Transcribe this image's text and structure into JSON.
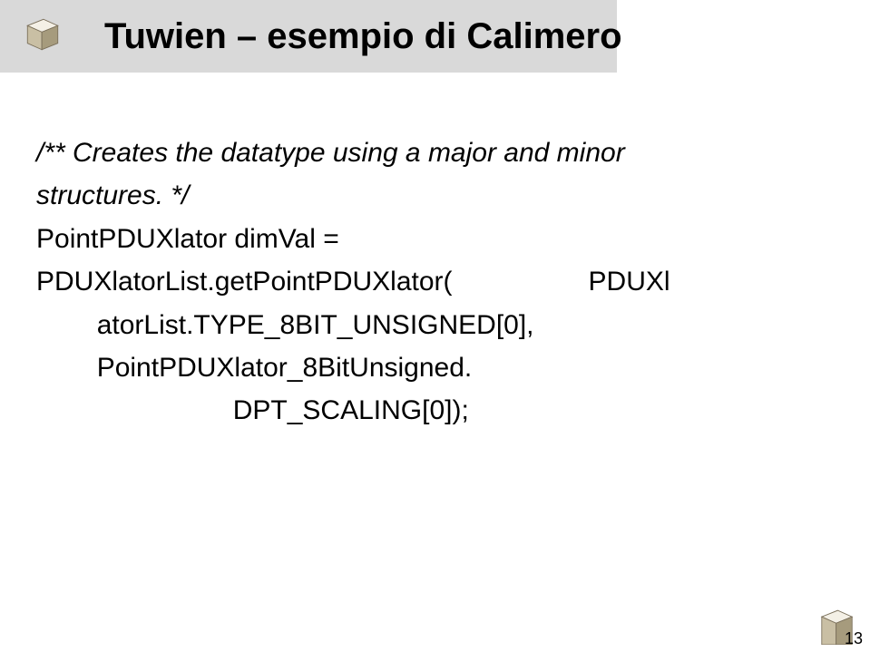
{
  "title": "Tuwien – esempio di Calimero",
  "code": {
    "comment_l1": "/** Creates the datatype using a major and minor",
    "comment_l2": "structures. */",
    "line1": "PointPDUXlator dimVal =",
    "blank": "",
    "line2a": "PDUXlatorList.getPointPDUXlator(",
    "line2b": "PDUXl",
    "line3": "atorList.TYPE_8BIT_UNSIGNED[0],",
    "line4": "PointPDUXlator_8BitUnsigned.",
    "line5": "DPT_SCALING[0]);"
  },
  "page_number": "13"
}
